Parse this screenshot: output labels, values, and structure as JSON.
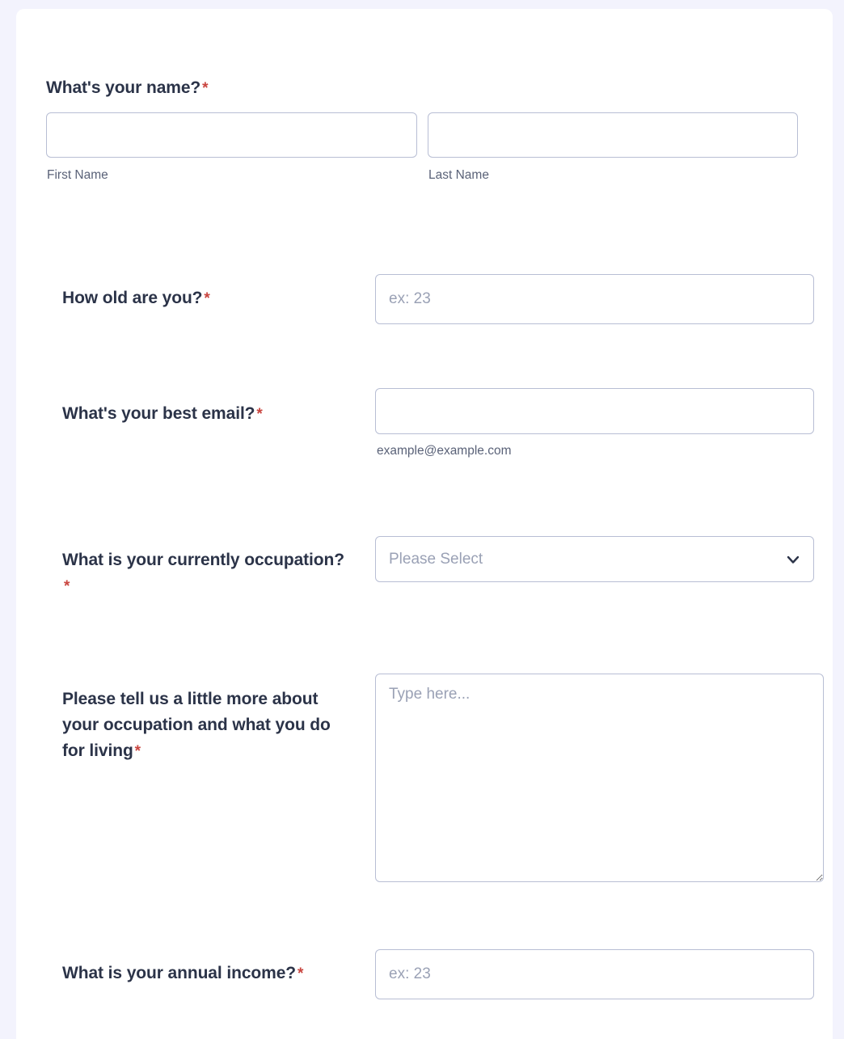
{
  "form": {
    "required_marker": "*",
    "colors": {
      "page_background": "#f3f3fd",
      "card_background": "#ffffff",
      "label_text": "#2b3348",
      "sub_label_text": "#5a6278",
      "placeholder_text": "#9aa1b5",
      "input_border": "#b8bed4",
      "required_asterisk": "#c9453f"
    },
    "questions": {
      "name": {
        "label": "What's your name?",
        "first": {
          "value": "",
          "placeholder": "",
          "sub_label": "First Name"
        },
        "last": {
          "value": "",
          "placeholder": "",
          "sub_label": "Last Name"
        }
      },
      "age": {
        "label": "How old are you?",
        "value": "",
        "placeholder": "ex: 23"
      },
      "email": {
        "label": "What's your best email?",
        "value": "",
        "placeholder": "",
        "sub_label": "example@example.com"
      },
      "occupation": {
        "label": "What is your currently occupation?",
        "selected": "Please Select",
        "chevron_icon": "chevron-down-icon"
      },
      "about": {
        "label": "Please tell us a little more about your occupation and what you do for living",
        "value": "",
        "placeholder": "Type here..."
      },
      "income": {
        "label": "What is your annual income?",
        "value": "",
        "placeholder": "ex: 23"
      }
    }
  }
}
